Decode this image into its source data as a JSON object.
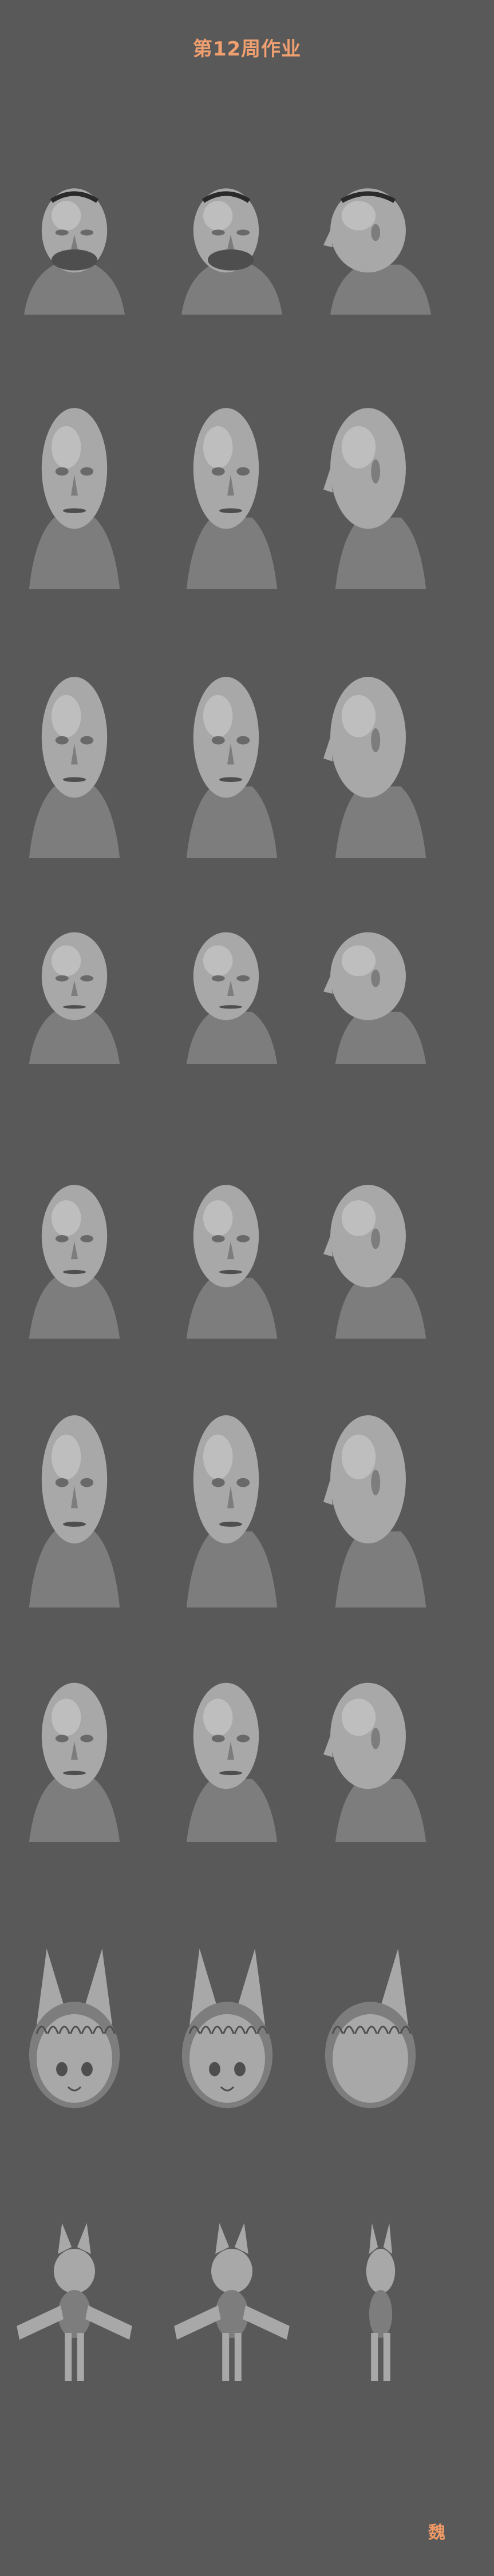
{
  "page": {
    "title": "第12周作业",
    "signature": "魏",
    "background": "#595959",
    "accent": "#f0a070"
  },
  "rows": [
    {
      "subject": "ogre-head",
      "views": [
        "front",
        "three-quarter",
        "side"
      ]
    },
    {
      "subject": "male-head-1",
      "views": [
        "front",
        "three-quarter",
        "side"
      ]
    },
    {
      "subject": "male-head-2",
      "views": [
        "front",
        "three-quarter",
        "side"
      ]
    },
    {
      "subject": "male-head-3",
      "views": [
        "front",
        "three-quarter",
        "side"
      ]
    },
    {
      "subject": "male-head-4",
      "views": [
        "front",
        "three-quarter",
        "side"
      ]
    },
    {
      "subject": "male-head-5",
      "views": [
        "front",
        "three-quarter",
        "side"
      ]
    },
    {
      "subject": "grinning-old-man-head",
      "views": [
        "front",
        "three-quarter",
        "side"
      ]
    },
    {
      "subject": "cat-eared-girl-head",
      "views": [
        "front",
        "three-quarter",
        "side"
      ]
    },
    {
      "subject": "cat-eared-girl-figure",
      "views": [
        "front",
        "three-quarter",
        "side"
      ]
    }
  ]
}
